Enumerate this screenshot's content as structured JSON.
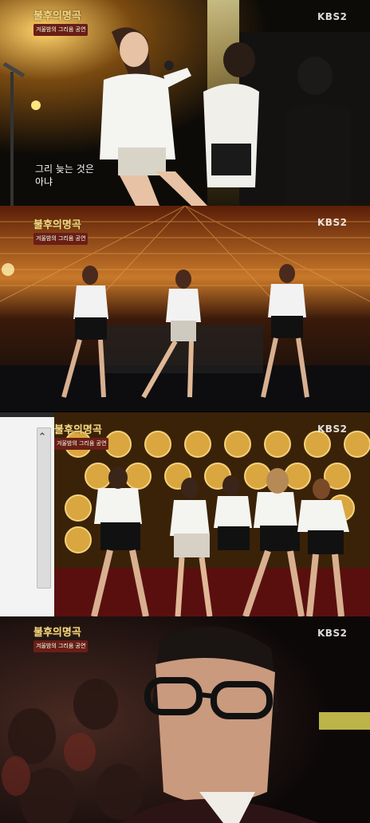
{
  "broadcaster": "KBS2",
  "show_logo": {
    "title": "불후의명곡",
    "subtitle": "겨울밤의 그리움 공연"
  },
  "subtitle_caption": {
    "line1": "그리 늦는 것은",
    "line2": "아냐"
  },
  "icons": {
    "scroll_up": "chevron-up-icon"
  },
  "colors": {
    "stage_gold": "#d9a640",
    "logo_gold": "#f2d98a",
    "logo_red": "#6b1e17"
  }
}
